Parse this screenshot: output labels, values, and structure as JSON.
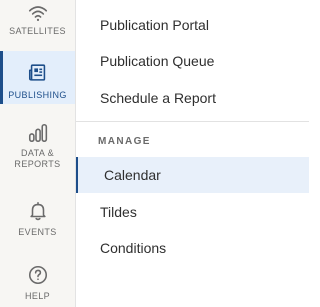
{
  "rail": {
    "items": [
      {
        "label": "SATELLITES",
        "icon": "wifi-icon",
        "active": false
      },
      {
        "label": "PUBLISHING",
        "icon": "newspaper-icon",
        "active": true
      },
      {
        "label": "DATA &\nREPORTS",
        "icon": "bar-chart-icon",
        "active": false
      },
      {
        "label": "EVENTS",
        "icon": "bell-icon",
        "active": false
      },
      {
        "label": "HELP",
        "icon": "question-circle-icon",
        "active": false
      }
    ]
  },
  "menu": {
    "items": [
      {
        "label": "Publication Portal"
      },
      {
        "label": "Publication Queue"
      },
      {
        "label": "Schedule a Report"
      }
    ],
    "section_title": "MANAGE",
    "manage_items": [
      {
        "label": "Calendar",
        "active": true
      },
      {
        "label": "Tildes",
        "active": false
      },
      {
        "label": "Conditions",
        "active": false
      }
    ]
  },
  "colors": {
    "accent": "#1d4e8a",
    "active_bg": "#e3eefb",
    "rail_bg": "#f7f6f3",
    "text": "#2f2f2f",
    "muted": "#6a6a6a"
  }
}
